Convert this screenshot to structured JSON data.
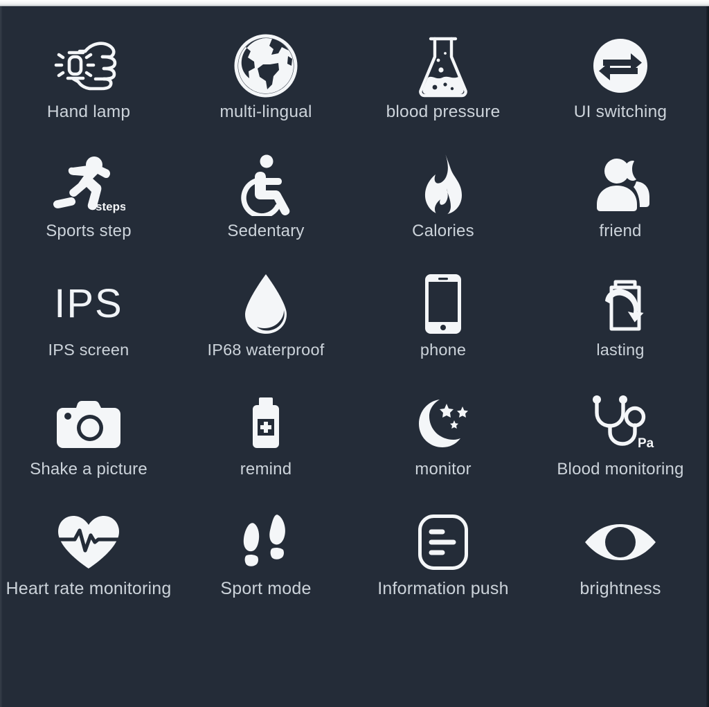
{
  "page": {
    "background_color": "#242c38",
    "icon_color": "#f4f6f8",
    "label_color": "#ccd3da",
    "columns": 4,
    "rows": 5
  },
  "features": [
    {
      "icon": "watch-fist-icon",
      "label": "Hand lamp"
    },
    {
      "icon": "globe-icon",
      "label": "multi-lingual"
    },
    {
      "icon": "flask-icon",
      "label": "blood pressure"
    },
    {
      "icon": "swap-arrows-circle-icon",
      "label": "UI switching"
    },
    {
      "icon": "runner-steps-icon",
      "label": "Sports step",
      "badge": "steps"
    },
    {
      "icon": "wheelchair-icon",
      "label": "Sedentary"
    },
    {
      "icon": "flame-icon",
      "label": "Calories"
    },
    {
      "icon": "two-users-icon",
      "label": "friend"
    },
    {
      "icon": "ips-text-icon",
      "label": "IPS screen",
      "glyph_text": "IPS"
    },
    {
      "icon": "water-drop-icon",
      "label": "IP68 waterproof"
    },
    {
      "icon": "smartphone-icon",
      "label": "phone"
    },
    {
      "icon": "battery-refresh-icon",
      "label": "lasting"
    },
    {
      "icon": "camera-icon",
      "label": "Shake a picture"
    },
    {
      "icon": "medicine-bottle-icon",
      "label": "remind"
    },
    {
      "icon": "moon-stars-icon",
      "label": "monitor"
    },
    {
      "icon": "stethoscope-icon",
      "label": "Blood monitoring",
      "badge": "Pa"
    },
    {
      "icon": "heart-pulse-icon",
      "label": "Heart rate monitoring"
    },
    {
      "icon": "footprints-icon",
      "label": "Sport mode"
    },
    {
      "icon": "message-lines-icon",
      "label": "Information push"
    },
    {
      "icon": "eye-icon",
      "label": "brightness"
    }
  ]
}
